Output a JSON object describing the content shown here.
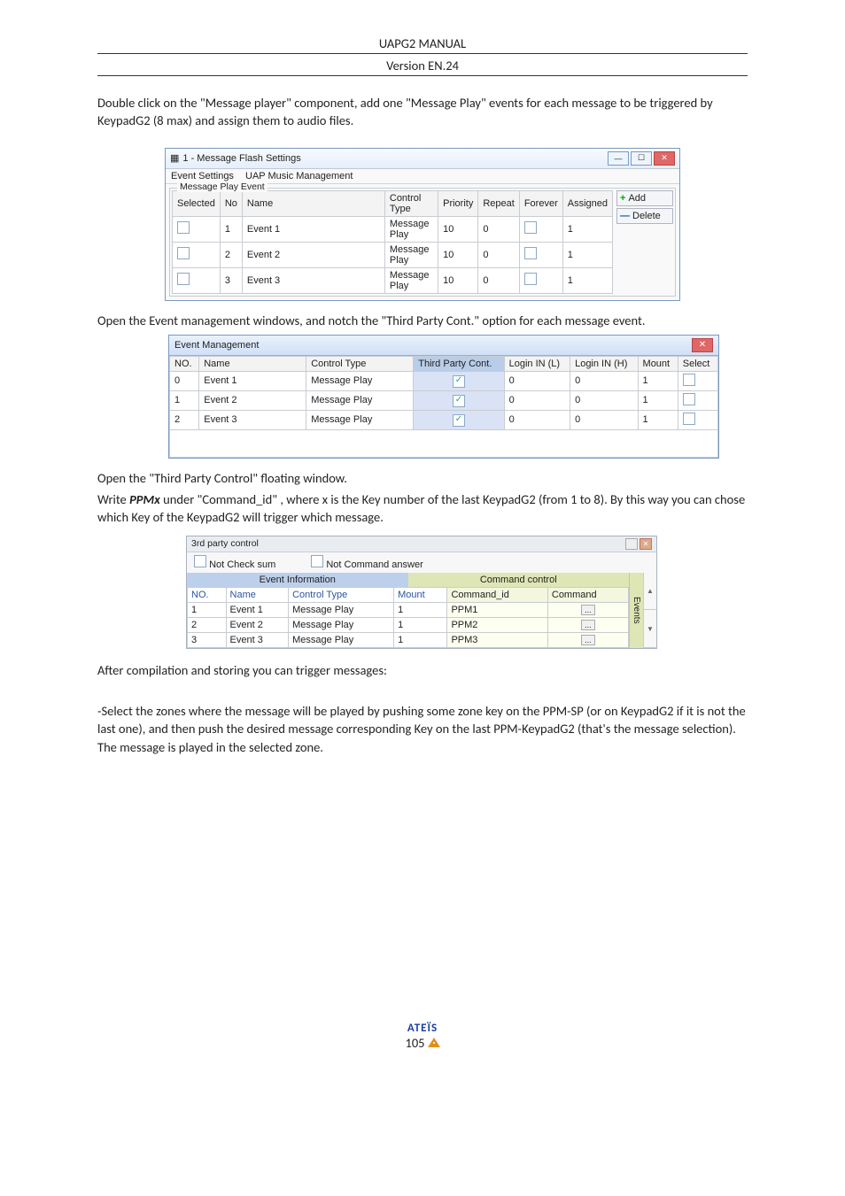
{
  "header": {
    "title": "UAPG2  MANUAL",
    "version": "Version EN.24"
  },
  "para1": "Double click on the \"Message player\" component, add one  \"Message Play\" events for each message to be triggered by KeypadG2 (8 max) and assign them to audio files.",
  "win1": {
    "title": "1 - Message Flash Settings",
    "menu": {
      "item1": "Event Settings",
      "item2": "UAP Music Management"
    },
    "group_label": "Message Play Event",
    "headers": {
      "selected": "Selected",
      "no": "No",
      "name": "Name",
      "ctype": "Control Type",
      "priority": "Priority",
      "repeat": "Repeat",
      "forever": "Forever",
      "assigned": "Assigned"
    },
    "rows": [
      {
        "no": "1",
        "name": "Event 1",
        "ctype": "Message Play",
        "priority": "10",
        "repeat": "0",
        "assigned": "1"
      },
      {
        "no": "2",
        "name": "Event 2",
        "ctype": "Message Play",
        "priority": "10",
        "repeat": "0",
        "assigned": "1"
      },
      {
        "no": "3",
        "name": "Event 3",
        "ctype": "Message Play",
        "priority": "10",
        "repeat": "0",
        "assigned": "1"
      }
    ],
    "btn_add": "Add",
    "btn_delete": "Delete"
  },
  "para2": "Open the Event management windows, and notch the \"Third Party Cont.\" option for each message event.",
  "win2": {
    "title": "Event Management",
    "headers": {
      "no": "NO.",
      "name": "Name",
      "ctype": "Control Type",
      "tpc": "Third Party Cont.",
      "ll": "Login IN (L)",
      "lh": "Login IN (H)",
      "mount": "Mount",
      "select": "Select"
    },
    "rows": [
      {
        "no": "0",
        "name": "Event 1",
        "ctype": "Message Play",
        "ll": "0",
        "lh": "0",
        "mount": "1"
      },
      {
        "no": "1",
        "name": "Event 2",
        "ctype": "Message Play",
        "ll": "0",
        "lh": "0",
        "mount": "1"
      },
      {
        "no": "2",
        "name": "Event 3",
        "ctype": "Message Play",
        "ll": "0",
        "lh": "0",
        "mount": "1"
      }
    ]
  },
  "para3a": "Open the \"Third Party Control\" floating window.",
  "para3b_pre": "Write ",
  "para3b_bold": "PPMx",
  "para3b_post": "  under \"Command_id\"  , where x is the Key number of the  last KeypadG2 (from 1 to 8). By this way you can chose which Key of the KeypadG2 will trigger which message.",
  "win3": {
    "title": "3rd party control",
    "opt1": "Not Check sum",
    "opt2": "Not Command answer",
    "sec1": "Event Information",
    "sec2": "Command control",
    "headers": {
      "no": "NO.",
      "name": "Name",
      "ctype": "Control Type",
      "mount": "Mount",
      "cmdid": "Command_id",
      "cmd": "Command"
    },
    "rows": [
      {
        "no": "1",
        "name": "Event 1",
        "ctype": "Message Play",
        "mount": "1",
        "cmdid": "PPM1"
      },
      {
        "no": "2",
        "name": "Event 2",
        "ctype": "Message Play",
        "mount": "1",
        "cmdid": "PPM2"
      },
      {
        "no": "3",
        "name": "Event 3",
        "ctype": "Message Play",
        "mount": "1",
        "cmdid": "PPM3"
      }
    ],
    "sidetab": "Events"
  },
  "para4": "After compilation and storing you can trigger messages:",
  "para5": "-Select the zones where the message will be played by pushing some zone key on the PPM-SP (or  on KeypadG2  if it is not the last one), and then push the desired message corresponding Key on the last PPM-KeypadG2 (that's the message selection). The message is played in the selected zone.",
  "footer": {
    "brand": "ATEÏS",
    "page": "105"
  }
}
